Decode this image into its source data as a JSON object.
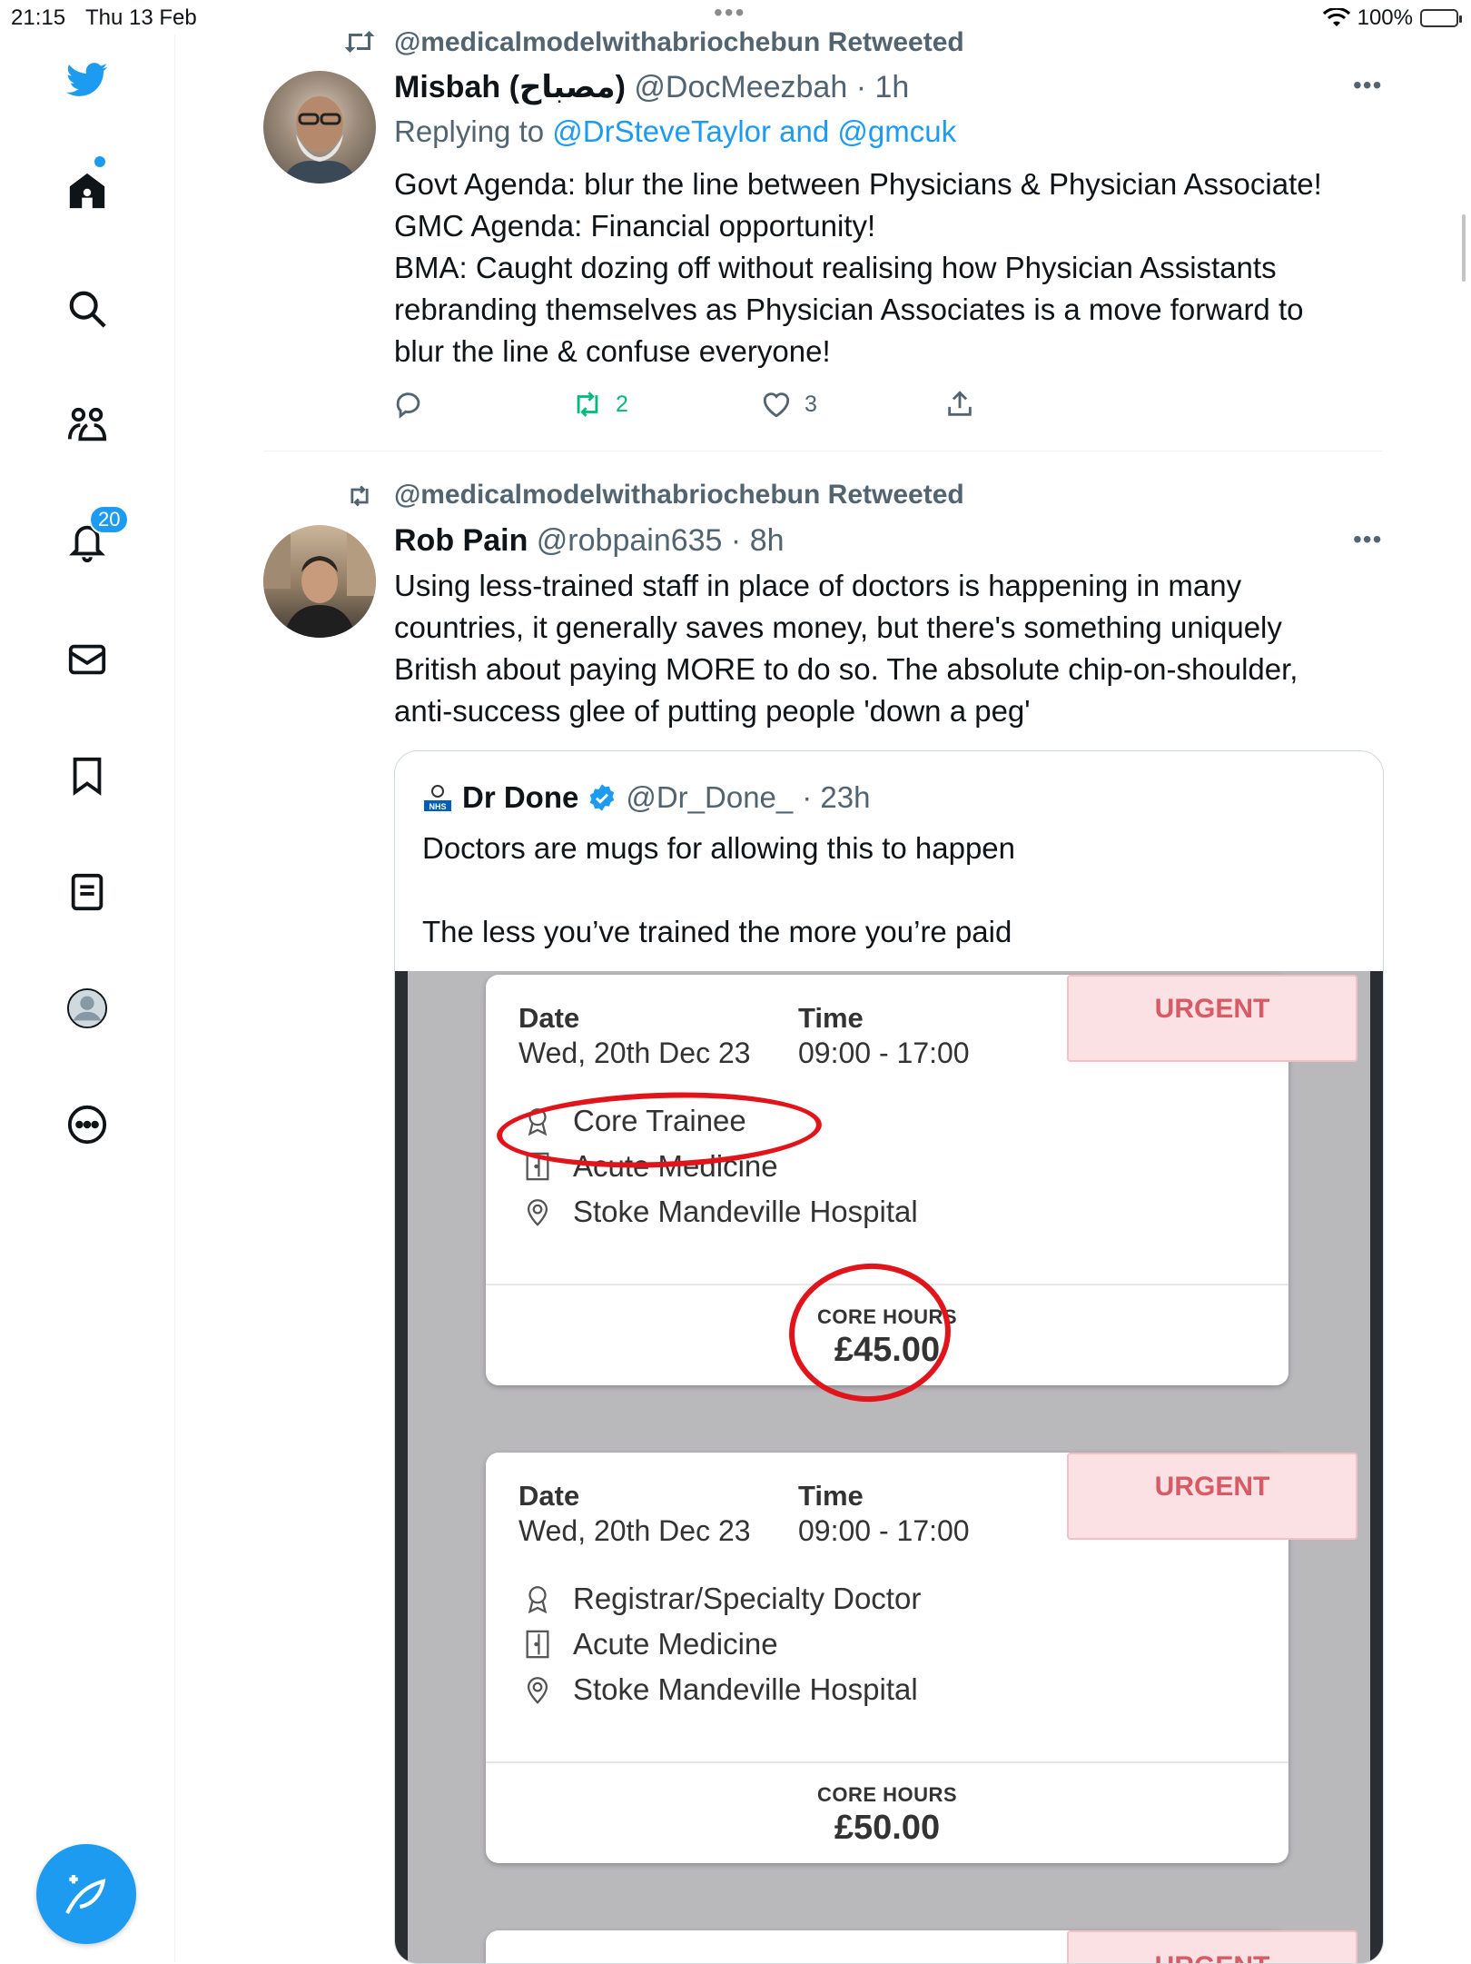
{
  "status_bar": {
    "time": "21:15",
    "date": "Thu 13 Feb",
    "battery": "100%",
    "dots": "•••"
  },
  "sidebar": {
    "notifications_badge": "20",
    "items": [
      "twitter-logo",
      "home",
      "search",
      "communities",
      "notifications",
      "messages",
      "bookmarks",
      "lists",
      "profile",
      "more"
    ]
  },
  "tweet1": {
    "retweet_label": "@medicalmodelwithabriochebun Retweeted",
    "name": "Misbah (مصباح)",
    "handle": "@DocMeezbah",
    "time": "· 1h",
    "reply_prefix": "Replying to ",
    "reply_to": "@DrSteveTaylor and @gmcuk",
    "text": "Govt Agenda: blur the line between Physicians & Physician Associate!\nGMC Agenda: Financial opportunity!\nBMA: Caught dozing off without realising how Physician Assistants rebranding themselves as Physician Associates is a move forward to blur the line & confuse everyone!",
    "retweets": "2",
    "likes": "3",
    "more": "•••"
  },
  "tweet2": {
    "retweet_label": "@medicalmodelwithabriochebun Retweeted",
    "name": "Rob Pain",
    "handle": "@robpain635",
    "time": "· 8h",
    "text": "Using less-trained staff in place of doctors is happening in many countries, it generally saves money, but there's something uniquely British about paying MORE to do so.  The absolute chip-on-shoulder, anti-success glee of putting people 'down a peg'",
    "more": "•••"
  },
  "quote": {
    "badge_text": "NHS",
    "name": "Dr Done",
    "handle": "@Dr_Done_",
    "time": "· 23h",
    "text": "Doctors are mugs for allowing this to happen\n\nThe less you’ve trained the more you’re paid"
  },
  "shift_cards": [
    {
      "date_label": "Date",
      "date": "Wed, 20th Dec 23",
      "time_label": "Time",
      "time": "09:00 - 17:00",
      "urgent": "URGENT",
      "grade": "Core Trainee",
      "department": "Acute Medicine",
      "hospital": "Stoke Mandeville Hospital",
      "hours_label": "CORE HOURS",
      "rate": "£45.00"
    },
    {
      "date_label": "Date",
      "date": "Wed, 20th Dec 23",
      "time_label": "Time",
      "time": "09:00 - 17:00",
      "urgent": "URGENT",
      "grade": "Registrar/Specialty Doctor",
      "department": "Acute Medicine",
      "hospital": "Stoke Mandeville Hospital",
      "hours_label": "CORE HOURS",
      "rate": "£50.00"
    }
  ],
  "third_card_urgent": "URGENT",
  "colors": {
    "accent": "#1d9bf0",
    "retweet_green": "#00ba7c",
    "urgent_bg": "#fbe1e3",
    "circle_red": "#e2141b"
  }
}
